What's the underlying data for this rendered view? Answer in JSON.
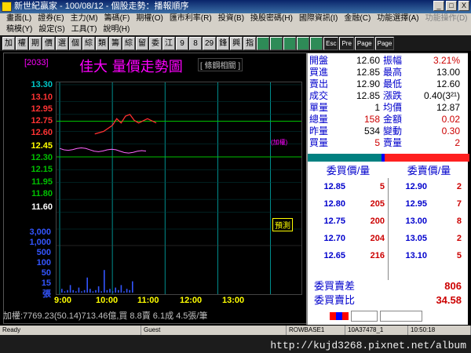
{
  "window": {
    "title": "新世紀贏家 - 100/08/12 - 個股走勢：播報順序",
    "buttons": [
      "_",
      "□",
      "X"
    ]
  },
  "menu": {
    "row1": [
      "畫面(L)",
      "證券(E)",
      "主力(M)",
      "籌碼(F)",
      "期權(O)",
      "匯市利率(R)",
      "投資(B)",
      "換股密碼(H)",
      "國際資訊(I)",
      "金融(C)",
      "功能選擇(A)",
      "功能操作(D)"
    ],
    "row2": [
      "稿模(Y)",
      "設定(S)",
      "工具(T)",
      "說明(H)"
    ]
  },
  "toolbar": [
    "加",
    "權",
    "期",
    "價",
    "選",
    "個",
    "綜",
    "類",
    "籌",
    "綜",
    "留",
    "委",
    "江",
    "9",
    "8",
    "29",
    "鋒",
    "興",
    "指",
    "",
    "",
    "",
    "",
    "",
    "Esc",
    "Pre",
    "Page",
    "Page"
  ],
  "chart": {
    "code": "[2033]",
    "title": "佳大  量價走勢圖",
    "subtitle": "[ 條鋼相關 ]",
    "annotation": "(加權)",
    "predict_label": "預測",
    "y_labels": [
      {
        "text": "13.30",
        "color": "#00c8c8"
      },
      {
        "text": "13.10",
        "color": "#ff3333"
      },
      {
        "text": "12.95",
        "color": "#ff3333"
      },
      {
        "text": "12.75",
        "color": "#ff3333"
      },
      {
        "text": "12.60",
        "color": "#ff3333"
      },
      {
        "text": "12.45",
        "color": "#ffff00"
      },
      {
        "text": "12.30",
        "color": "#00c000"
      },
      {
        "text": "12.15",
        "color": "#00c000"
      },
      {
        "text": "11.95",
        "color": "#00c000"
      },
      {
        "text": "11.80",
        "color": "#00c000"
      },
      {
        "text": "11.60",
        "color": "#ffffff"
      }
    ],
    "vol_labels": [
      "3,000",
      "1,000",
      "500",
      "100",
      "50",
      "15",
      "張"
    ],
    "x_labels": [
      "9:00",
      "10:00",
      "11:00",
      "12:00",
      "13:00"
    ],
    "colors": {
      "price_line": "#ff3030",
      "index_line": "#ff66ff",
      "ref_line": "#00c000",
      "grid": "#00c8c8",
      "volume": "#3355ff"
    }
  },
  "chart_data": {
    "type": "line",
    "x": [
      "9:00",
      "9:10",
      "9:20",
      "9:30",
      "9:40",
      "9:50",
      "10:00",
      "10:05",
      "10:10",
      "10:15",
      "10:20",
      "10:25",
      "10:30",
      "10:40",
      "10:50"
    ],
    "series": [
      {
        "name": "佳大",
        "values": [
          null,
          null,
          null,
          null,
          12.72,
          12.75,
          12.82,
          12.9,
          12.85,
          12.93,
          12.95,
          12.88,
          12.85,
          12.9,
          12.85
        ]
      }
    ],
    "ylim": [
      11.6,
      13.3
    ],
    "y_ticks": [
      13.3,
      13.1,
      12.95,
      12.75,
      12.6,
      12.45,
      12.3,
      12.15,
      11.95,
      11.8,
      11.6
    ],
    "x_ticks": [
      "9:00",
      "10:00",
      "11:00",
      "12:00",
      "13:00"
    ],
    "title": "佳大  量價走勢圖"
  },
  "stats": [
    {
      "l1": "開盤",
      "v1": "12.60",
      "l2": "振幅",
      "v2": "3.21%",
      "c1": "",
      "c2": "red"
    },
    {
      "l1": "買進",
      "v1": "12.85",
      "l2": "最高",
      "v2": "13.00",
      "c1": "",
      "c2": ""
    },
    {
      "l1": "賣出",
      "v1": "12.90",
      "l2": "最低",
      "v2": "12.60",
      "c1": "",
      "c2": ""
    },
    {
      "l1": "成交",
      "v1": "12.85",
      "l2": "漲跌",
      "v2": "0.40(3²¹)",
      "c1": "",
      "c2": ""
    },
    {
      "l1": "單量",
      "v1": "1",
      "l2": "均價",
      "v2": "12.87",
      "c1": "",
      "c2": ""
    },
    {
      "l1": "總量",
      "v1": "158",
      "l2": "金額",
      "v2": "0.02",
      "c1": "red",
      "c2": "red"
    },
    {
      "l1": "昨量",
      "v1": "534",
      "l2": "變動",
      "v2": "0.30",
      "c1": "",
      "c2": "red"
    },
    {
      "l1": "買量",
      "v1": "5",
      "l2": "賣量",
      "v2": "2",
      "c1": "red",
      "c2": "red"
    }
  ],
  "orderbook": {
    "bid_header": "委買價/量",
    "ask_header": "委賣價/量",
    "rows": [
      {
        "bp": "12.85",
        "bs": "5",
        "ap": "12.90",
        "as": "2"
      },
      {
        "bp": "12.80",
        "bs": "205",
        "ap": "12.95",
        "as": "7"
      },
      {
        "bp": "12.75",
        "bs": "200",
        "ap": "13.00",
        "as": "8"
      },
      {
        "bp": "12.70",
        "bs": "204",
        "ap": "13.05",
        "as": "2"
      },
      {
        "bp": "12.65",
        "bs": "216",
        "ap": "13.10",
        "as": "5"
      }
    ]
  },
  "diff": [
    {
      "label": "委買賣差",
      "value": "806"
    },
    {
      "label": "委買賣比",
      "value": "34.58"
    }
  ],
  "statusline": "加權:7769.23(50.14)713.46億,買 8.8賣 6.1成 4.5張/筆",
  "statusright": {
    "code": "2033",
    "time": "10:50:18/"
  },
  "winstatus": [
    "Ready",
    "Guest",
    "ROWBASE1",
    "10A37478_1",
    "10:50:18"
  ],
  "watermark": "http://kujd3268.pixnet.net/album"
}
